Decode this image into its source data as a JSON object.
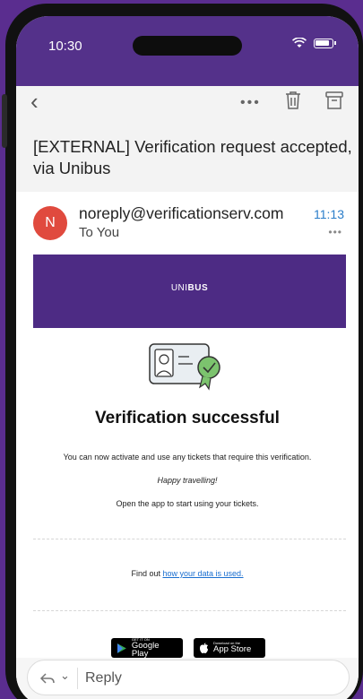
{
  "status_bar": {
    "time": "10:30"
  },
  "email": {
    "subject": "[EXTERNAL] Verification request accepted, via Unibus",
    "sender": {
      "avatar_initial": "N",
      "address": "noreply@verificationserv.com",
      "recipient": "To You",
      "time": "11:13"
    },
    "brand": {
      "light": "UNI",
      "bold": "BUS"
    },
    "headline": "Verification successful",
    "paragraph_1": "You can now activate and use any tickets that require this verification.",
    "paragraph_2": "Happy travelling!",
    "paragraph_3": "Open the app to start using your tickets.",
    "data_prefix": "Find out ",
    "data_link": "how your data is used.",
    "badges": {
      "google_small": "GET IT ON",
      "google_big": "Google Play",
      "apple_small": "Download on the",
      "apple_big": "App Store"
    }
  },
  "reply": {
    "label": "Reply"
  },
  "colors": {
    "brand": "#54318a",
    "link": "#1a6fd0",
    "avatar": "#e04a3e",
    "time": "#2a7dc9"
  }
}
